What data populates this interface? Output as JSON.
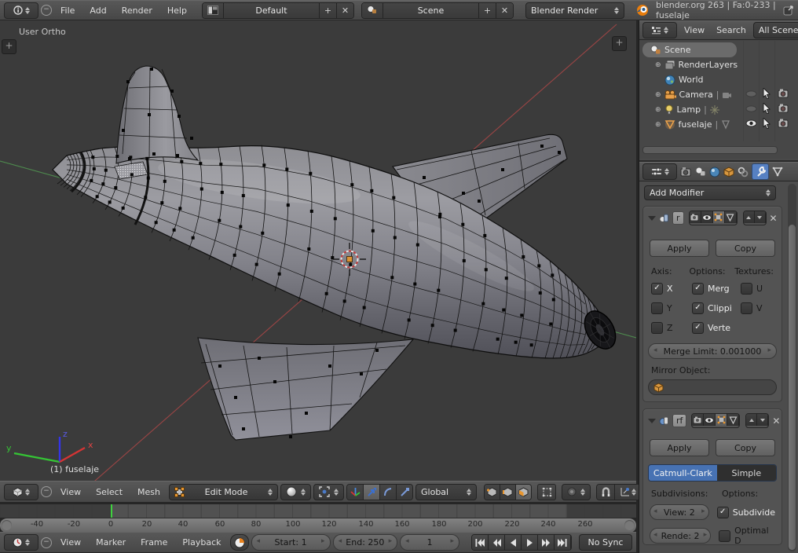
{
  "infobar": {
    "menus": [
      "File",
      "Add",
      "Render",
      "Help"
    ],
    "screen_value": "Default",
    "scene_value": "Scene",
    "engine_value": "Blender Render",
    "status_text": "blender.org 263 | Fa:0-233 | fuselaje"
  },
  "viewport": {
    "view_label": "User Ortho",
    "object_info": "(1) fuselaje",
    "axis_x": "x",
    "axis_y": "y",
    "axis_z": "z"
  },
  "view3d_header": {
    "menus": [
      "View",
      "Select",
      "Mesh"
    ],
    "mode_value": "Edit Mode",
    "orientation_value": "Global"
  },
  "outliner": {
    "menus": [
      "View",
      "Search"
    ],
    "scope_value": "All Scenes",
    "rows": [
      {
        "label": "Scene"
      },
      {
        "label": "RenderLayers"
      },
      {
        "label": "World"
      },
      {
        "label": "Camera"
      },
      {
        "label": "Lamp"
      },
      {
        "label": "fuselaje"
      }
    ]
  },
  "properties": {
    "add_modifier_label": "Add Modifier",
    "mirror": {
      "name": "r",
      "apply_label": "Apply",
      "copy_label": "Copy",
      "axis_label": "Axis:",
      "options_label": "Options:",
      "textures_label": "Textures:",
      "checks": [
        {
          "label": "X",
          "checked": true
        },
        {
          "label": "Merg",
          "checked": true
        },
        {
          "label": "U",
          "checked": false
        },
        {
          "label": "Y",
          "checked": false
        },
        {
          "label": "Clippi",
          "checked": true
        },
        {
          "label": "V",
          "checked": false
        },
        {
          "label": "Z",
          "checked": false
        },
        {
          "label": "Verte",
          "checked": true
        }
      ],
      "merge_limit_label": "Merge Limit: 0.001000",
      "mirror_object_label": "Mirror Object:"
    },
    "subsurf": {
      "name": "rf",
      "apply_label": "Apply",
      "copy_label": "Copy",
      "catmull_label": "Catmull-Clark",
      "simple_label": "Simple",
      "subdivisions_label": "Subdivisions:",
      "options_label": "Options:",
      "view_label": "View: 2",
      "render_label": "Rende: 2",
      "subdivide_label": "Subdivide",
      "optimal_label": "Optimal D"
    },
    "accent_blue": "#4772b3"
  },
  "timeline": {
    "menus": [
      "View",
      "Marker",
      "Frame",
      "Playback"
    ],
    "ticks": [
      "-40",
      "-20",
      "0",
      "20",
      "40",
      "60",
      "80",
      "100",
      "120",
      "140",
      "160",
      "180",
      "200",
      "220",
      "240",
      "260"
    ],
    "start_value": "Start: 1",
    "end_value": "End: 250",
    "frame_value": "1",
    "sync_value": "No Sync"
  }
}
